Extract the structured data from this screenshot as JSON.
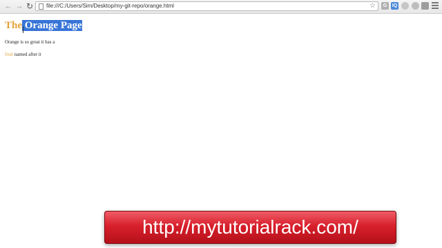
{
  "browser": {
    "back_glyph": "←",
    "forward_glyph": "→",
    "reload_glyph": "↻",
    "url": "file:///C:/Users/Sim/Desktop/my-git-repo/orange.html",
    "bookmark_glyph": "☆",
    "extensions": [
      {
        "name": "extension-icon",
        "label": "G"
      },
      {
        "name": "iq-icon",
        "label": "IQ"
      },
      {
        "name": "extension-icon",
        "label": ""
      },
      {
        "name": "extension-icon",
        "label": ""
      },
      {
        "name": "extension-icon",
        "label": ""
      }
    ]
  },
  "page": {
    "title_plain": "The",
    "title_selected": " Orange Page",
    "para1": "Orange is so great it has a",
    "para2_link": "fruit",
    "para2_rest": " named after it",
    "accent_color": "#e3a33a",
    "selection_color": "#3875d7"
  },
  "watermark": {
    "text": "http://mytutorialrack.com/"
  }
}
